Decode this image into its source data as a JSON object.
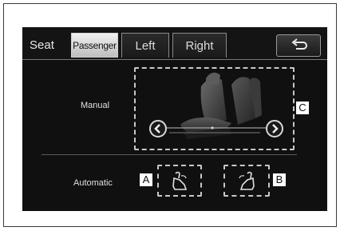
{
  "tabs": {
    "seat": "Seat",
    "passenger": "Passenger",
    "left": "Left",
    "right": "Right"
  },
  "icons": {
    "back": "back-arrow-icon",
    "prev": "chevron-left-icon",
    "next": "chevron-right-icon",
    "seat_memory": "seat-memory-icon"
  },
  "rows": {
    "manual": "Manual",
    "automatic": "Automatic"
  },
  "callouts": {
    "a": "A",
    "b": "B",
    "c": "C"
  },
  "colors": {
    "screen_bg": "#101010",
    "active_tab": "#e6e6e6",
    "dashed_outline": "#c8c8c8"
  }
}
